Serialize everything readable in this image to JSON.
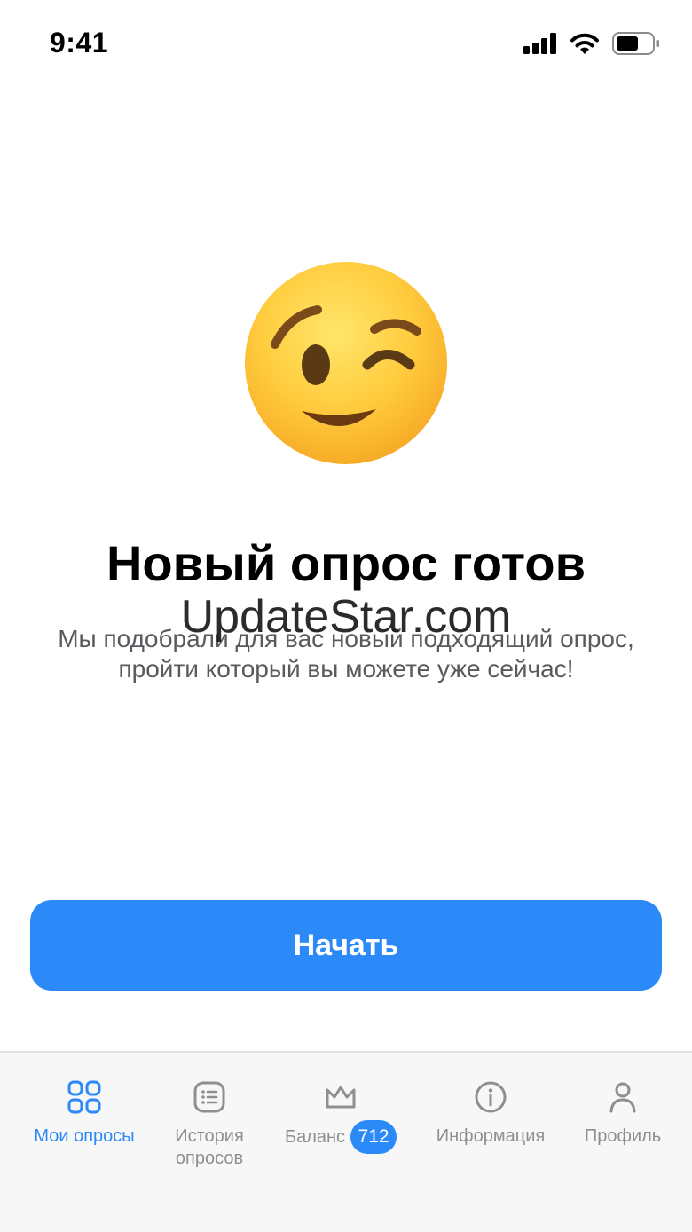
{
  "status_bar": {
    "time": "9:41"
  },
  "emoji": {
    "name": "winking-face"
  },
  "content": {
    "title": "Новый опрос готов",
    "subtitle_line1": "Мы подобрали для вас новый подходящий опрос,",
    "subtitle_line2": "пройти который вы можете уже сейчас!",
    "watermark": "UpdateStar.com"
  },
  "start_button": {
    "label": "Начать"
  },
  "tab_bar": {
    "active_color": "#2b8af7",
    "inactive_color": "#8e8e93",
    "tabs": [
      {
        "label": "Мои опросы",
        "icon": "grid-icon",
        "active": true
      },
      {
        "label_line1": "История",
        "label_line2": "опросов",
        "icon": "list-icon",
        "active": false
      },
      {
        "label": "Баланс",
        "badge": "712",
        "icon": "crown-icon",
        "active": false
      },
      {
        "label": "Информация",
        "icon": "info-icon",
        "active": false
      },
      {
        "label": "Профиль",
        "icon": "person-icon",
        "active": false
      }
    ]
  }
}
